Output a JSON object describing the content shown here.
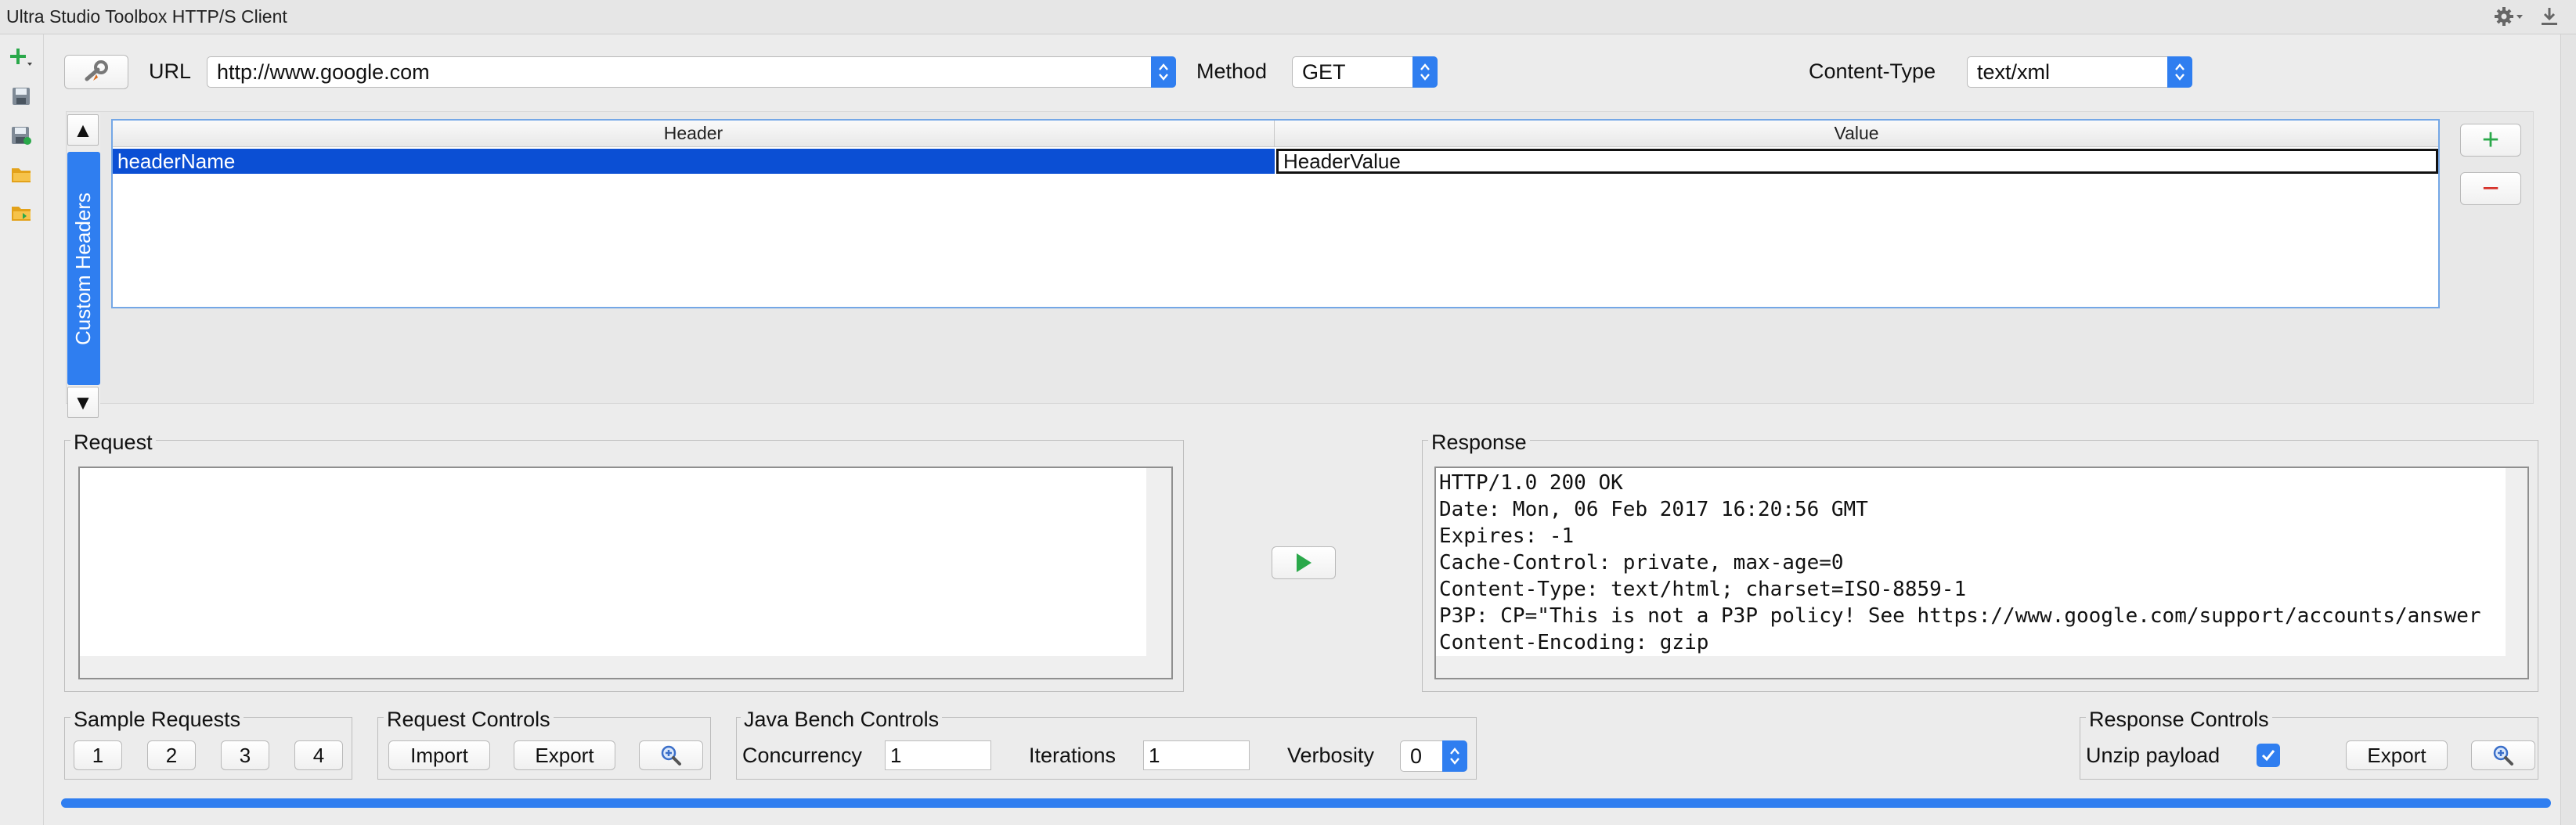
{
  "window": {
    "title": "Ultra Studio Toolbox HTTP/S Client"
  },
  "toolbar": {
    "url_label": "URL",
    "url_value": "http://www.google.com",
    "method_label": "Method",
    "method_value": "GET",
    "content_type_label": "Content-Type",
    "content_type_value": "text/xml"
  },
  "headers": {
    "tab_label": "Custom Headers",
    "columns": [
      "Header",
      "Value"
    ],
    "rows": [
      {
        "header": "headerName",
        "value": "HeaderValue"
      }
    ],
    "add_symbol": "+",
    "remove_symbol": "−",
    "scroll_up": "▲",
    "scroll_down": "▼"
  },
  "request": {
    "title": "Request",
    "body": ""
  },
  "response": {
    "title": "Response",
    "lines": [
      "HTTP/1.0 200 OK",
      "Date: Mon, 06 Feb 2017 16:20:56 GMT",
      "Expires: -1",
      "Cache-Control: private, max-age=0",
      "Content-Type: text/html; charset=ISO-8859-1",
      "P3P: CP=\"This is not a P3P policy! See https://www.google.com/support/accounts/answer",
      "Content-Encoding: gzip"
    ]
  },
  "sample_requests": {
    "title": "Sample Requests",
    "buttons": [
      "1",
      "2",
      "3",
      "4"
    ]
  },
  "request_controls": {
    "title": "Request Controls",
    "import_label": "Import",
    "export_label": "Export"
  },
  "bench_controls": {
    "title": "Java Bench Controls",
    "concurrency_label": "Concurrency",
    "concurrency_value": "1",
    "iterations_label": "Iterations",
    "iterations_value": "1",
    "verbosity_label": "Verbosity",
    "verbosity_value": "0"
  },
  "response_controls": {
    "title": "Response Controls",
    "unzip_label": "Unzip payload",
    "unzip_checked": true,
    "export_label": "Export"
  },
  "colors": {
    "accent": "#2f7ef0",
    "selection": "#0b4fd4",
    "play": "#2aa84a"
  }
}
